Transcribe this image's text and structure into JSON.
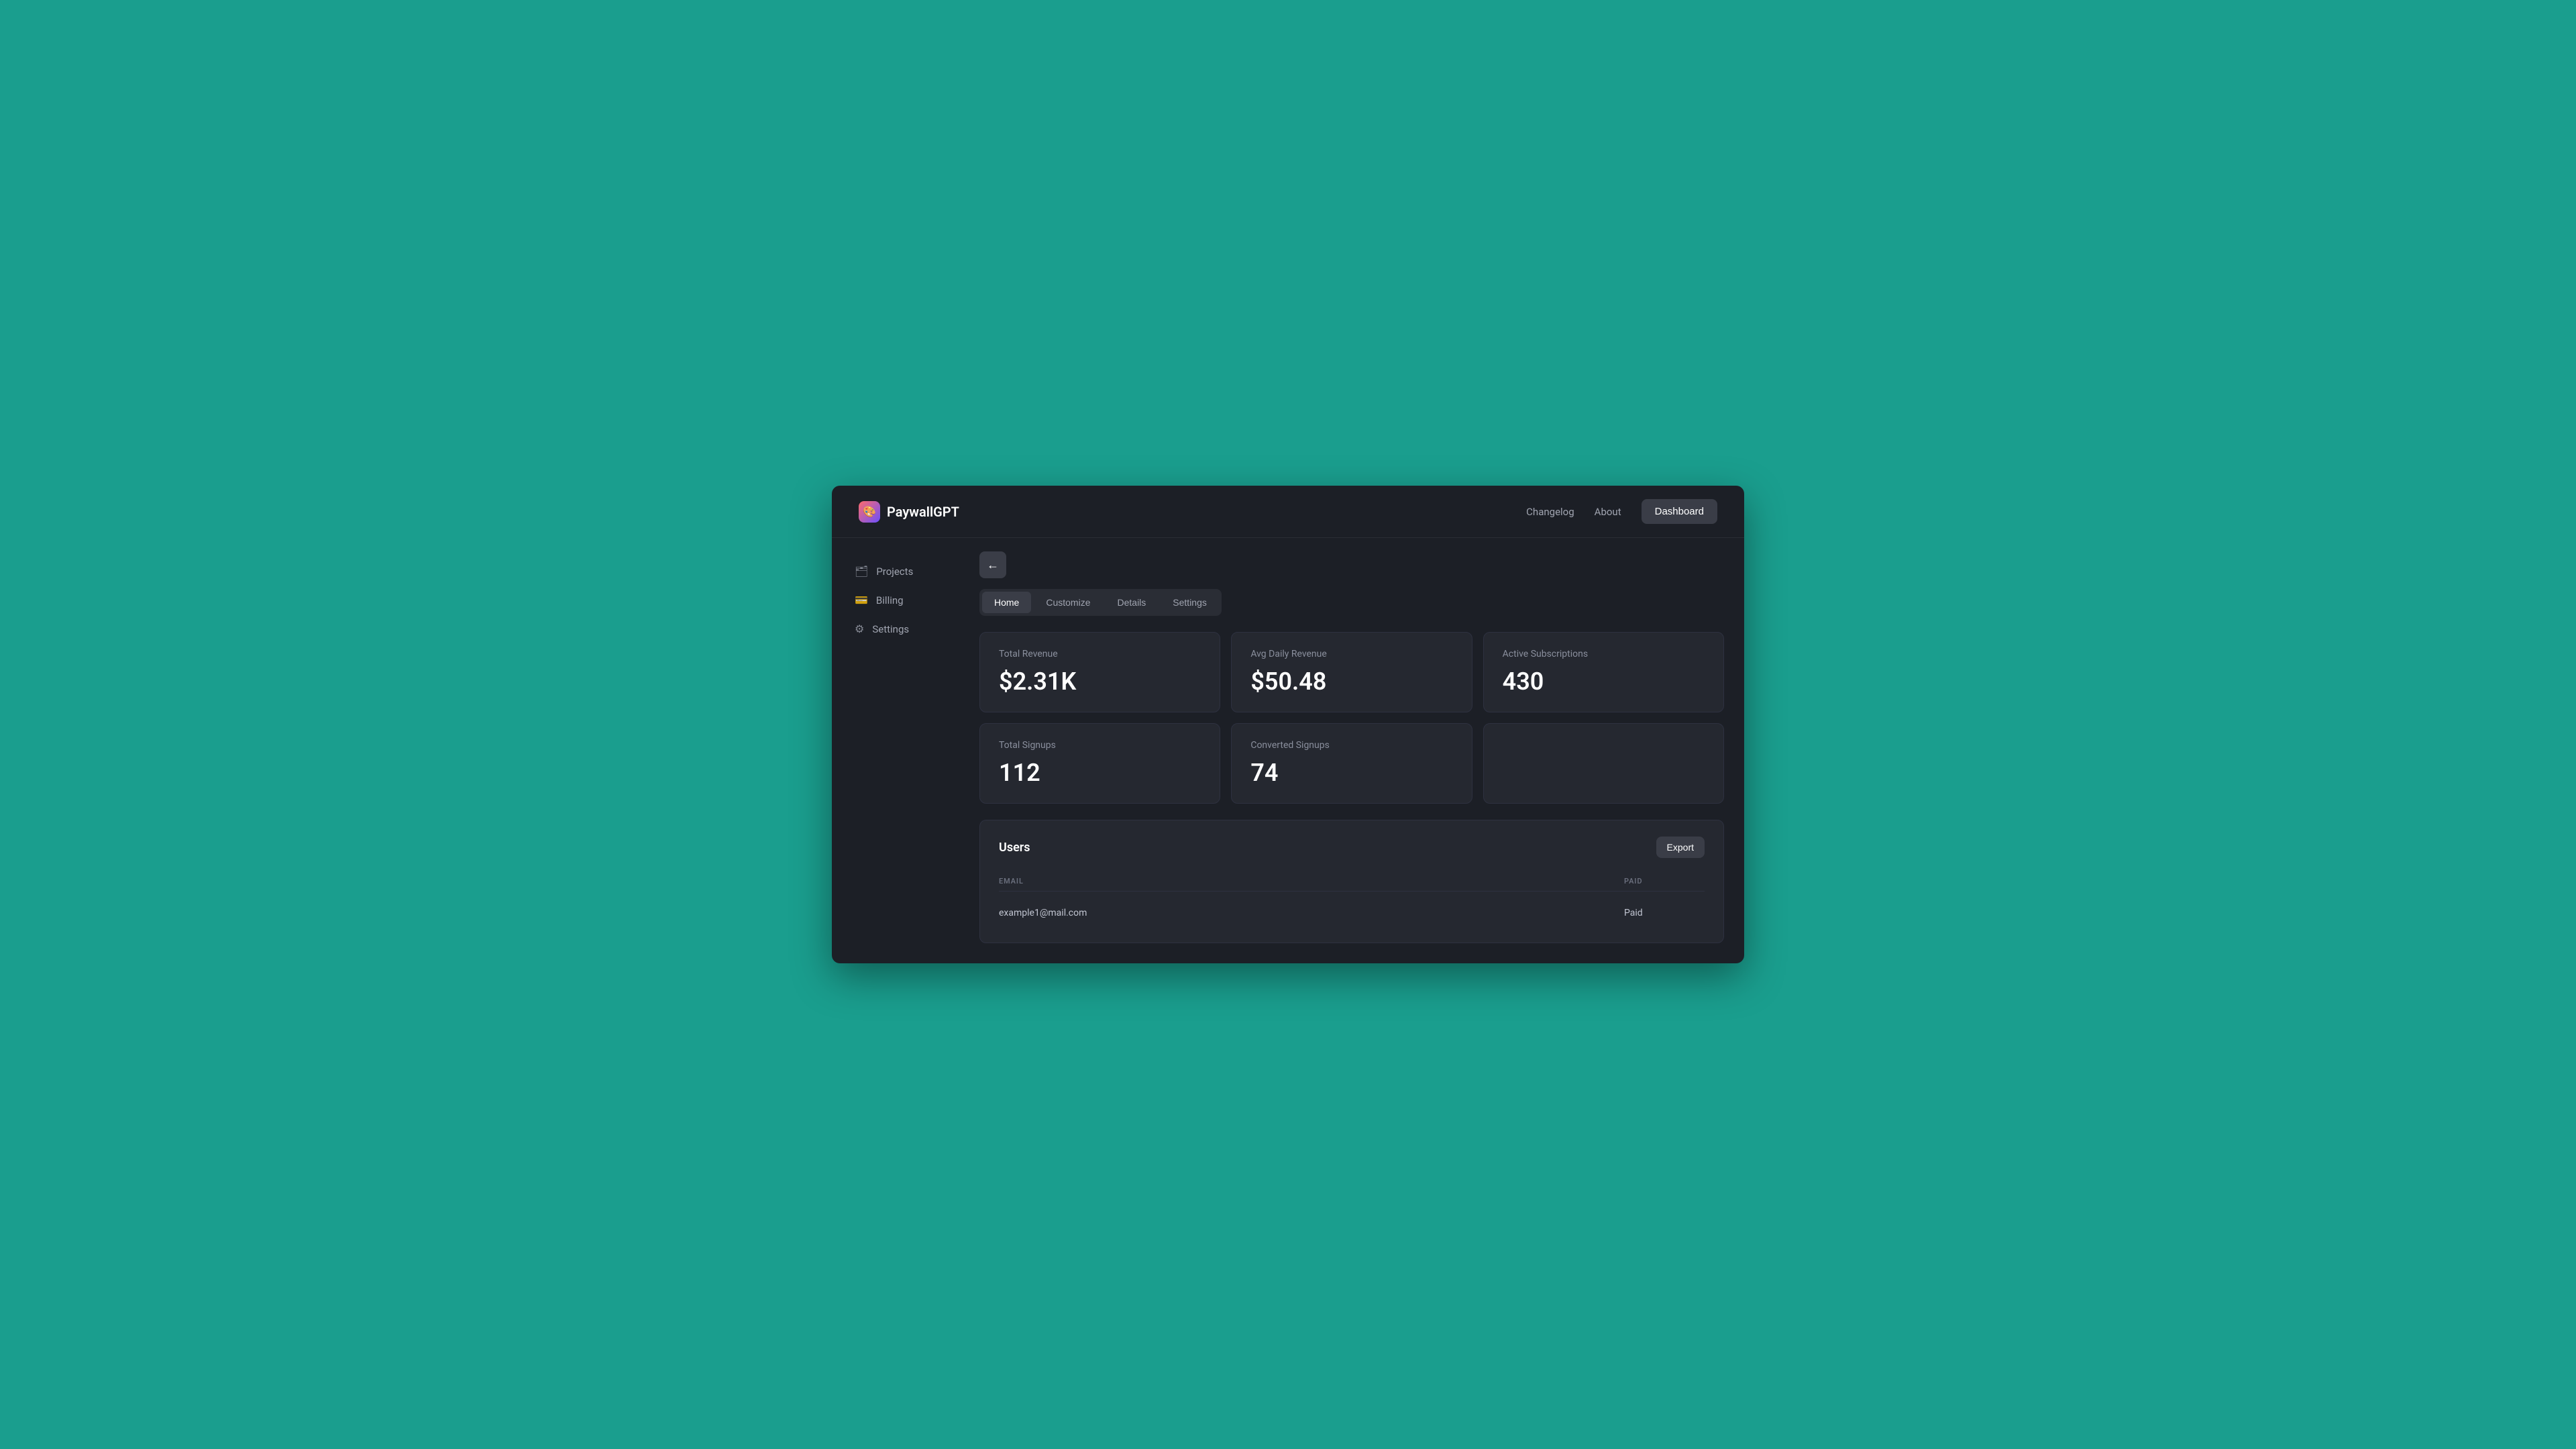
{
  "app": {
    "name": "PaywallGPT",
    "logo_emoji": "🎨"
  },
  "header": {
    "nav_links": [
      {
        "label": "Changelog",
        "id": "changelog"
      },
      {
        "label": "About",
        "id": "about"
      }
    ],
    "dashboard_button": "Dashboard"
  },
  "sidebar": {
    "items": [
      {
        "label": "Projects",
        "icon": "🗂",
        "id": "projects"
      },
      {
        "label": "Billing",
        "icon": "💳",
        "id": "billing"
      },
      {
        "label": "Settings",
        "icon": "⚙",
        "id": "settings"
      }
    ]
  },
  "tabs": [
    {
      "label": "Home",
      "active": true
    },
    {
      "label": "Customize",
      "active": false
    },
    {
      "label": "Details",
      "active": false
    },
    {
      "label": "Settings",
      "active": false
    }
  ],
  "stats": [
    {
      "label": "Total Revenue",
      "value": "$2.31K"
    },
    {
      "label": "Avg Daily Revenue",
      "value": "$50.48"
    },
    {
      "label": "Active Subscriptions",
      "value": "430"
    },
    {
      "label": "Total Signups",
      "value": "112"
    },
    {
      "label": "Converted Signups",
      "value": "74"
    }
  ],
  "users_section": {
    "title": "Users",
    "export_button": "Export",
    "columns": [
      {
        "label": "EMAIL"
      },
      {
        "label": "PAID"
      }
    ],
    "rows": [
      {
        "email": "example1@mail.com",
        "paid": "Paid"
      }
    ]
  },
  "colors": {
    "bg_teal": "#1a9e8e",
    "bg_dark": "#1c1f26",
    "card_bg": "#252830",
    "active_tab": "#3a3d47",
    "text_primary": "#ffffff",
    "text_secondary": "#a0a4b0",
    "text_muted": "#6a6f7d"
  }
}
